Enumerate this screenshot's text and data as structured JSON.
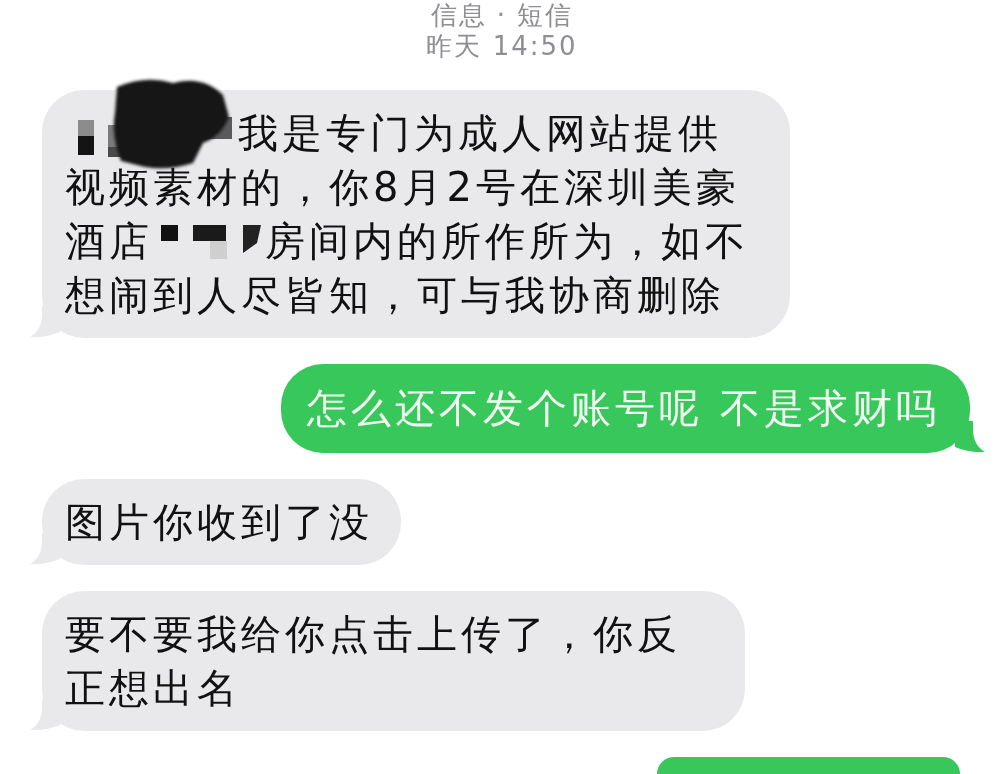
{
  "header": {
    "title": "信息 · 短信",
    "timestamp": "昨天 14:50"
  },
  "messages": [
    {
      "kind": "received",
      "segments": [
        {
          "kind": "scribble"
        },
        {
          "kind": "text",
          "text": "我是专门为成人网站提供视频素材的，你8月2号在深圳美豪酒店"
        },
        {
          "kind": "mosaic"
        },
        {
          "kind": "text",
          "text": "房间内的所作所为，如不想闹到人尽皆知，可与我协商删除"
        }
      ]
    },
    {
      "kind": "sent",
      "segments": [
        {
          "kind": "text",
          "text": "怎么还不发个账号呢 不是求财吗"
        }
      ]
    },
    {
      "kind": "received",
      "segments": [
        {
          "kind": "text",
          "text": "图片你收到了没"
        }
      ]
    },
    {
      "kind": "received",
      "segments": [
        {
          "kind": "text",
          "text": "要不要我给你点击上传了，你反正想出名"
        }
      ]
    },
    {
      "kind": "sent"
    }
  ]
}
